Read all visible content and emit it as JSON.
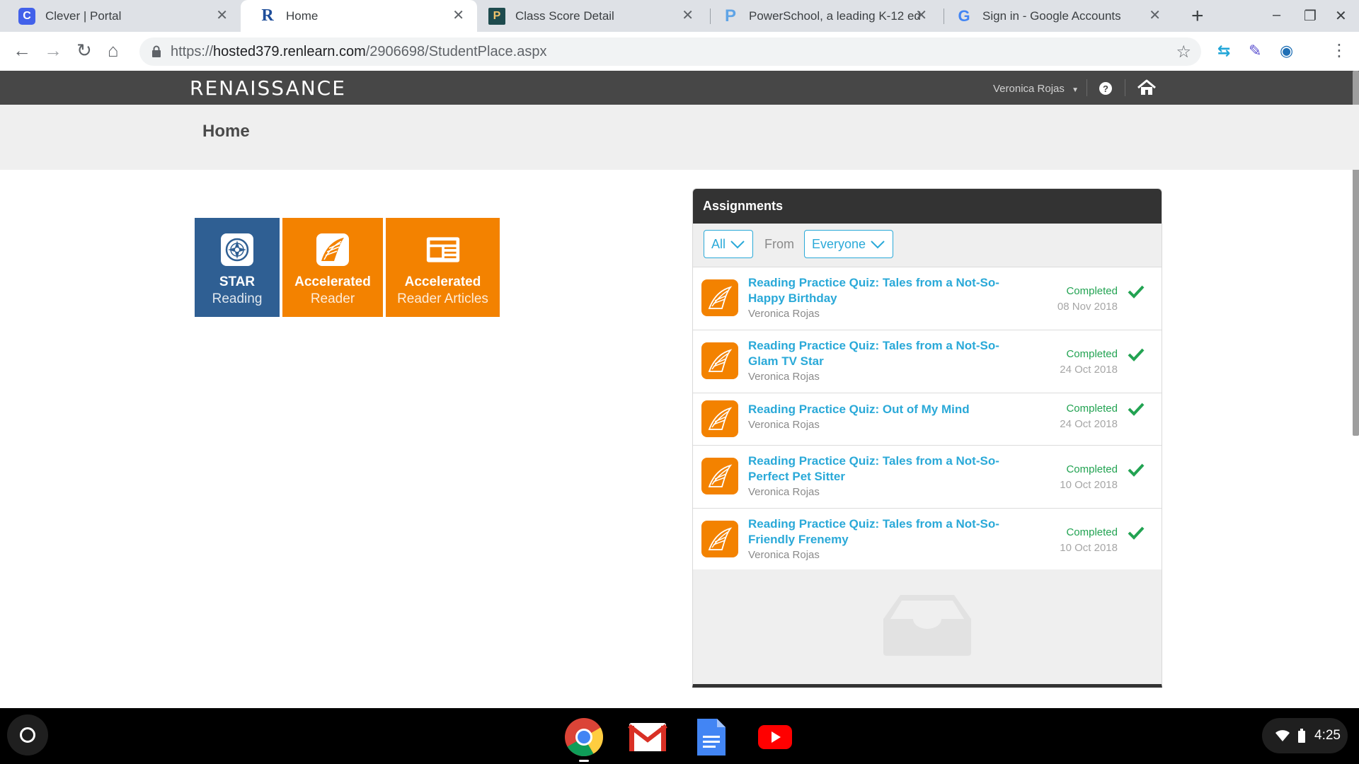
{
  "browser": {
    "tabs": [
      {
        "title": "Clever | Portal",
        "favicon": "clever-icon",
        "favicon_text": "C",
        "active": false
      },
      {
        "title": "Home",
        "favicon": "renaissance-icon",
        "favicon_text": "R",
        "active": true
      },
      {
        "title": "Class Score Detail",
        "favicon": "powerschool-icon",
        "favicon_text": "P",
        "active": false
      },
      {
        "title": "PowerSchool, a leading K-12 ed",
        "favicon": "powerschool-p-icon",
        "favicon_text": "P",
        "active": false
      },
      {
        "title": "Sign in - Google Accounts",
        "favicon": "google-icon",
        "favicon_text": "G",
        "active": false
      }
    ],
    "url_prefix": "https://",
    "url_host": "hosted379.renlearn.com",
    "url_path": "/2906698/StudentPlace.aspx"
  },
  "app": {
    "brand": "RENAISSANCE",
    "user_name": "Veronica Rojas",
    "help_symbol": "?",
    "page_title": "Home"
  },
  "tiles": [
    {
      "line1": "STAR",
      "line2": "Reading",
      "icon": "compass-icon",
      "color": "#2f5f93"
    },
    {
      "line1": "Accelerated",
      "line2": "Reader",
      "icon": "book-feather-icon",
      "color": "#f38200"
    },
    {
      "line1": "Accelerated",
      "line2": "Reader Articles",
      "icon": "newspaper-icon",
      "color": "#f38200"
    }
  ],
  "assignments": {
    "header": "Assignments",
    "filter_type": "All",
    "from_label": "From",
    "filter_from": "Everyone",
    "items": [
      {
        "title_line1": "Reading Practice Quiz: Tales from a Not-So-",
        "title_line2": "Happy Birthday",
        "student": "Veronica Rojas",
        "status": "Completed",
        "date": "08 Nov 2018"
      },
      {
        "title_line1": "Reading Practice Quiz: Tales from a Not-So-",
        "title_line2": "Glam TV Star",
        "student": "Veronica Rojas",
        "status": "Completed",
        "date": "24 Oct 2018"
      },
      {
        "title_line1": "Reading Practice Quiz: Out of My Mind",
        "title_line2": "",
        "student": "Veronica Rojas",
        "status": "Completed",
        "date": "24 Oct 2018"
      },
      {
        "title_line1": "Reading Practice Quiz: Tales from a Not-So-",
        "title_line2": "Perfect Pet Sitter",
        "student": "Veronica Rojas",
        "status": "Completed",
        "date": "10 Oct 2018"
      },
      {
        "title_line1": "Reading Practice Quiz: Tales from a Not-So-",
        "title_line2": "Friendly Frenemy",
        "student": "Veronica Rojas",
        "status": "Completed",
        "date": "10 Oct 2018"
      }
    ]
  },
  "shelf": {
    "apps": [
      "chrome-icon",
      "gmail-icon",
      "docs-icon",
      "youtube-icon"
    ],
    "time": "4:25"
  },
  "colors": {
    "accent": "#2aa9d8",
    "orange": "#f38200",
    "star_blue": "#2f5f93",
    "header": "#474747",
    "completed": "#22a352"
  }
}
